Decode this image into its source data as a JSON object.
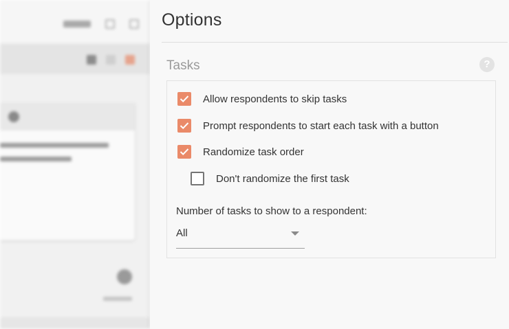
{
  "options": {
    "title": "Options",
    "section_title": "Tasks",
    "help_glyph": "?",
    "checkboxes": [
      {
        "label": "Allow respondents to skip tasks",
        "checked": true
      },
      {
        "label": "Prompt respondents to start each task with a button",
        "checked": true
      },
      {
        "label": "Randomize task order",
        "checked": true
      },
      {
        "label": "Don't randomize the first task",
        "checked": false
      }
    ],
    "count_label": "Number of tasks to show to a respondent:",
    "count_select": {
      "value": "All"
    }
  },
  "icons": {
    "help": "help-circle-icon",
    "check": "checkmark-icon",
    "dropdown": "chevron-down-icon"
  },
  "colors": {
    "accent": "#ea8a69",
    "text": "#333333",
    "muted": "#9a9a9a",
    "panel_bg": "#f8f8f8"
  }
}
